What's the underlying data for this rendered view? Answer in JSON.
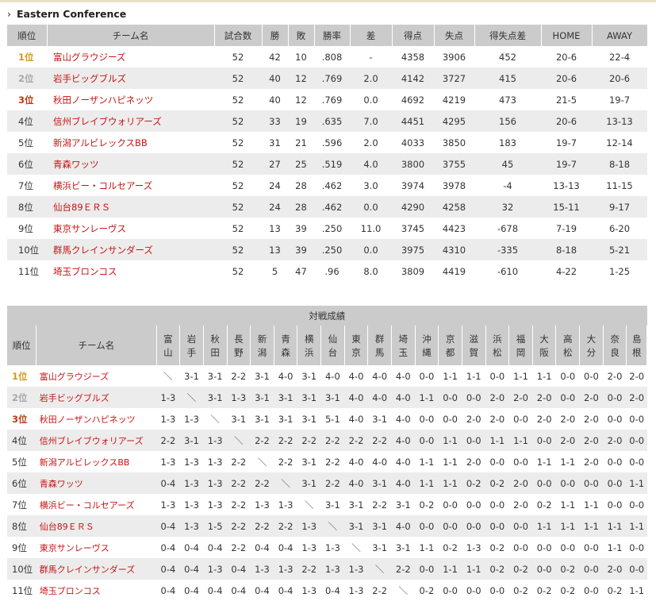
{
  "conference_title": "Eastern Conference",
  "standings": {
    "headers": [
      "順位",
      "チーム名",
      "試合数",
      "勝",
      "敗",
      "勝率",
      "差",
      "得点",
      "失点",
      "得失点差",
      "HOME",
      "AWAY"
    ],
    "rows": [
      {
        "rank": "1位",
        "team": "富山グラウジーズ",
        "g": "52",
        "w": "42",
        "l": "10",
        "pct": ".808",
        "gb": "-",
        "pf": "4358",
        "pa": "3906",
        "diff": "452",
        "home": "20-6",
        "away": "22-4"
      },
      {
        "rank": "2位",
        "team": "岩手ビッグブルズ",
        "g": "52",
        "w": "40",
        "l": "12",
        "pct": ".769",
        "gb": "2.0",
        "pf": "4142",
        "pa": "3727",
        "diff": "415",
        "home": "20-6",
        "away": "20-6"
      },
      {
        "rank": "3位",
        "team": "秋田ノーザンハピネッツ",
        "g": "52",
        "w": "40",
        "l": "12",
        "pct": ".769",
        "gb": "0.0",
        "pf": "4692",
        "pa": "4219",
        "diff": "473",
        "home": "21-5",
        "away": "19-7"
      },
      {
        "rank": "4位",
        "team": "信州ブレイブウォリアーズ",
        "g": "52",
        "w": "33",
        "l": "19",
        "pct": ".635",
        "gb": "7.0",
        "pf": "4451",
        "pa": "4295",
        "diff": "156",
        "home": "20-6",
        "away": "13-13"
      },
      {
        "rank": "5位",
        "team": "新潟アルビレックスBB",
        "g": "52",
        "w": "31",
        "l": "21",
        "pct": ".596",
        "gb": "2.0",
        "pf": "4033",
        "pa": "3850",
        "diff": "183",
        "home": "19-7",
        "away": "12-14"
      },
      {
        "rank": "6位",
        "team": "青森ワッツ",
        "g": "52",
        "w": "27",
        "l": "25",
        "pct": ".519",
        "gb": "4.0",
        "pf": "3800",
        "pa": "3755",
        "diff": "45",
        "home": "19-7",
        "away": "8-18"
      },
      {
        "rank": "7位",
        "team": "横浜ビー・コルセアーズ",
        "g": "52",
        "w": "24",
        "l": "28",
        "pct": ".462",
        "gb": "3.0",
        "pf": "3974",
        "pa": "3978",
        "diff": "-4",
        "home": "13-13",
        "away": "11-15"
      },
      {
        "rank": "8位",
        "team": "仙台89ＥＲＳ",
        "g": "52",
        "w": "24",
        "l": "28",
        "pct": ".462",
        "gb": "0.0",
        "pf": "4290",
        "pa": "4258",
        "diff": "32",
        "home": "15-11",
        "away": "9-17"
      },
      {
        "rank": "9位",
        "team": "東京サンレーヴス",
        "g": "52",
        "w": "13",
        "l": "39",
        "pct": ".250",
        "gb": "11.0",
        "pf": "3745",
        "pa": "4423",
        "diff": "-678",
        "home": "7-19",
        "away": "6-20"
      },
      {
        "rank": "10位",
        "team": "群馬クレインサンダーズ",
        "g": "52",
        "w": "13",
        "l": "39",
        "pct": ".250",
        "gb": "0.0",
        "pf": "3975",
        "pa": "4310",
        "diff": "-335",
        "home": "8-18",
        "away": "5-21"
      },
      {
        "rank": "11位",
        "team": "埼玉ブロンコス",
        "g": "52",
        "w": "5",
        "l": "47",
        "pct": ".96",
        "gb": "8.0",
        "pf": "3809",
        "pa": "4419",
        "diff": "-610",
        "home": "4-22",
        "away": "1-25"
      }
    ]
  },
  "head_to_head": {
    "caption": "対戦成績",
    "rank_header": "順位",
    "team_header": "チーム名",
    "opponents": [
      [
        "富",
        "山"
      ],
      [
        "岩",
        "手"
      ],
      [
        "秋",
        "田"
      ],
      [
        "長",
        "野"
      ],
      [
        "新",
        "潟"
      ],
      [
        "青",
        "森"
      ],
      [
        "横",
        "浜"
      ],
      [
        "仙",
        "台"
      ],
      [
        "東",
        "京"
      ],
      [
        "群",
        "馬"
      ],
      [
        "埼",
        "玉"
      ],
      [
        "沖",
        "縄"
      ],
      [
        "京",
        "都"
      ],
      [
        "滋",
        "賀"
      ],
      [
        "浜",
        "松"
      ],
      [
        "福",
        "岡"
      ],
      [
        "大",
        "阪"
      ],
      [
        "高",
        "松"
      ],
      [
        "大",
        "分"
      ],
      [
        "奈",
        "良"
      ],
      [
        "島",
        "根"
      ]
    ],
    "rows": [
      {
        "rank": "1位",
        "team": "富山グラウジーズ",
        "results": [
          "＼",
          "3-1",
          "3-1",
          "2-2",
          "3-1",
          "4-0",
          "3-1",
          "4-0",
          "4-0",
          "4-0",
          "4-0",
          "0-0",
          "1-1",
          "1-1",
          "0-0",
          "1-1",
          "1-1",
          "0-0",
          "0-0",
          "2-0",
          "2-0"
        ]
      },
      {
        "rank": "2位",
        "team": "岩手ビッグブルズ",
        "results": [
          "1-3",
          "＼",
          "3-1",
          "1-3",
          "3-1",
          "3-1",
          "3-1",
          "3-1",
          "4-0",
          "4-0",
          "4-0",
          "1-1",
          "0-0",
          "0-0",
          "2-0",
          "2-0",
          "2-0",
          "0-0",
          "2-0",
          "0-0",
          "2-0"
        ]
      },
      {
        "rank": "3位",
        "team": "秋田ノーザンハピネッツ",
        "results": [
          "1-3",
          "1-3",
          "＼",
          "3-1",
          "3-1",
          "3-1",
          "3-1",
          "5-1",
          "4-0",
          "3-1",
          "4-0",
          "0-0",
          "0-0",
          "2-0",
          "2-0",
          "0-0",
          "2-0",
          "2-0",
          "2-0",
          "0-0",
          "0-0"
        ]
      },
      {
        "rank": "4位",
        "team": "信州ブレイブウォリアーズ",
        "results": [
          "2-2",
          "3-1",
          "1-3",
          "＼",
          "2-2",
          "2-2",
          "2-2",
          "2-2",
          "2-2",
          "2-2",
          "4-0",
          "0-0",
          "1-1",
          "0-0",
          "1-1",
          "1-1",
          "0-0",
          "2-0",
          "2-0",
          "2-0",
          "0-0"
        ]
      },
      {
        "rank": "5位",
        "team": "新潟アルビレックスBB",
        "results": [
          "1-3",
          "1-3",
          "1-3",
          "2-2",
          "＼",
          "2-2",
          "3-1",
          "2-2",
          "4-0",
          "4-0",
          "4-0",
          "1-1",
          "1-1",
          "2-0",
          "0-0",
          "0-0",
          "1-1",
          "1-1",
          "2-0",
          "0-0",
          "0-0"
        ]
      },
      {
        "rank": "6位",
        "team": "青森ワッツ",
        "results": [
          "0-4",
          "1-3",
          "1-3",
          "2-2",
          "2-2",
          "＼",
          "3-1",
          "2-2",
          "4-0",
          "3-1",
          "4-0",
          "1-1",
          "1-1",
          "0-2",
          "0-2",
          "2-0",
          "0-0",
          "0-0",
          "0-0",
          "0-0",
          "1-1"
        ]
      },
      {
        "rank": "7位",
        "team": "横浜ビー・コルセアーズ",
        "results": [
          "1-3",
          "1-3",
          "1-3",
          "2-2",
          "1-3",
          "1-3",
          "＼",
          "3-1",
          "3-1",
          "2-2",
          "3-1",
          "0-2",
          "0-0",
          "0-0",
          "0-0",
          "2-0",
          "0-2",
          "1-1",
          "1-1",
          "0-0",
          "0-0"
        ]
      },
      {
        "rank": "8位",
        "team": "仙台89ＥＲＳ",
        "results": [
          "0-4",
          "1-3",
          "1-5",
          "2-2",
          "2-2",
          "2-2",
          "1-3",
          "＼",
          "3-1",
          "3-1",
          "4-0",
          "0-0",
          "0-0",
          "0-0",
          "0-0",
          "0-0",
          "1-1",
          "1-1",
          "1-1",
          "1-1",
          "1-1"
        ]
      },
      {
        "rank": "9位",
        "team": "東京サンレーヴス",
        "results": [
          "0-4",
          "0-4",
          "0-4",
          "2-2",
          "0-4",
          "0-4",
          "1-3",
          "1-3",
          "＼",
          "3-1",
          "3-1",
          "1-1",
          "0-2",
          "1-3",
          "0-2",
          "0-0",
          "0-0",
          "0-0",
          "0-0",
          "1-1",
          "0-0"
        ]
      },
      {
        "rank": "10位",
        "team": "群馬クレインサンダーズ",
        "results": [
          "0-4",
          "0-4",
          "1-3",
          "0-4",
          "1-3",
          "1-3",
          "2-2",
          "1-3",
          "1-3",
          "＼",
          "2-2",
          "0-0",
          "1-1",
          "1-1",
          "0-2",
          "0-2",
          "0-0",
          "0-2",
          "0-0",
          "2-0",
          "0-0"
        ]
      },
      {
        "rank": "11位",
        "team": "埼玉ブロンコス",
        "results": [
          "0-4",
          "0-4",
          "0-4",
          "0-4",
          "0-4",
          "0-4",
          "1-3",
          "0-4",
          "1-3",
          "2-2",
          "＼",
          "0-2",
          "0-0",
          "0-0",
          "0-0",
          "0-2",
          "0-2",
          "0-2",
          "0-0",
          "0-2",
          "1-1"
        ]
      }
    ]
  },
  "colors": {
    "rank1": "#d39a1b",
    "rank2": "#a8a8a8",
    "rank3": "#bb3a10",
    "team_link": "#c81414",
    "header_bg": "#cbcbcb",
    "alt_row_bg": "#ececec"
  }
}
